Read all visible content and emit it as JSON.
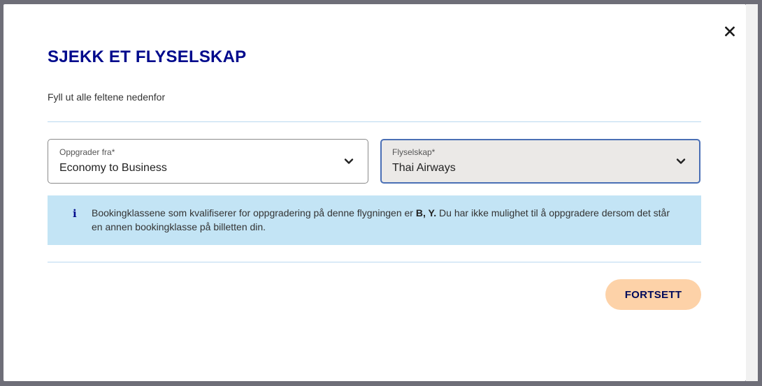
{
  "modal": {
    "title": "SJEKK ET FLYSELSKAP",
    "subtitle": "Fyll ut alle feltene nedenfor",
    "close_icon": "close-icon"
  },
  "form": {
    "upgrade": {
      "label": "Oppgrader fra*",
      "value": "Economy to Business",
      "icon": "chevron-down-icon"
    },
    "airline": {
      "label": "Flyselskap*",
      "value": "Thai Airways",
      "icon": "chevron-down-icon"
    }
  },
  "info": {
    "icon": "info-icon",
    "text_before": "Bookingklassene som kvalifiserer for oppgradering på denne flygningen er ",
    "classes": "B, Y.",
    "text_after": " Du har ikke mulighet til å oppgradere dersom det står en annen bookingklasse på billetten din."
  },
  "actions": {
    "continue_label": "FORTSETT"
  },
  "colors": {
    "title": "#000a8c",
    "info_bg": "#c3e4f5",
    "button_bg": "#fdd2a8",
    "divider": "#b9d9f0"
  }
}
